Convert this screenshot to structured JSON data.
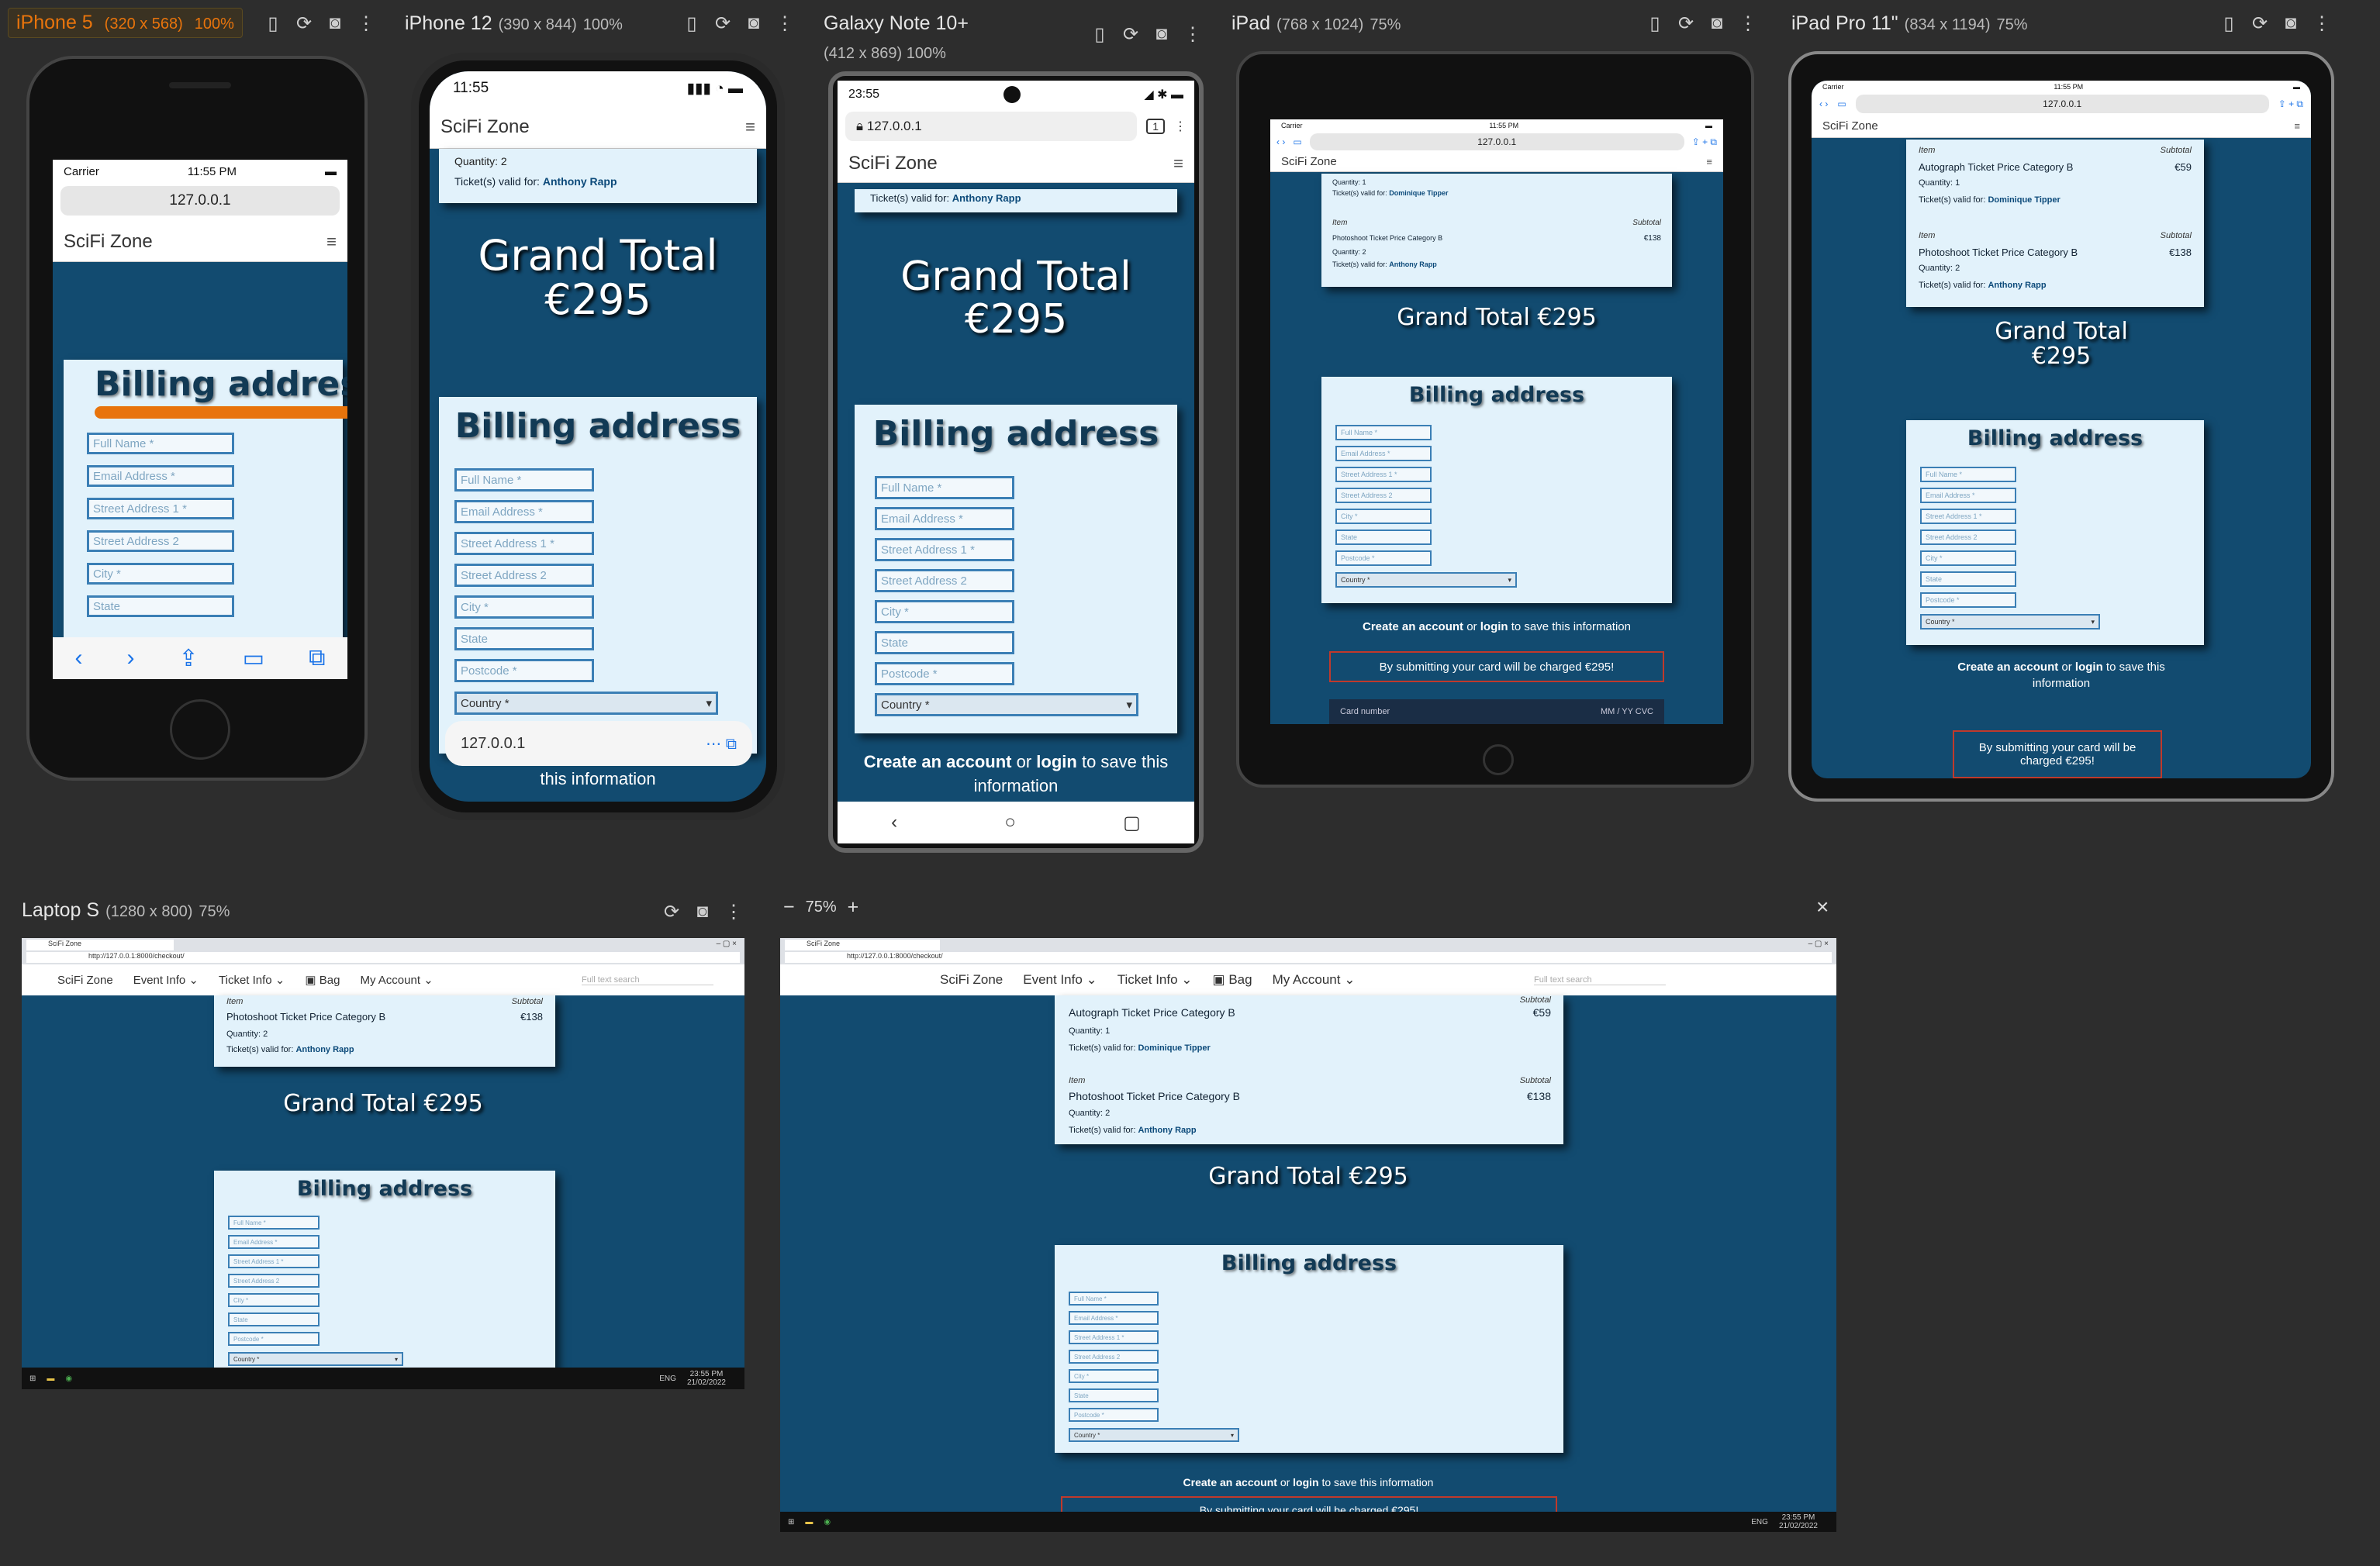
{
  "panels": {
    "iphone5": {
      "name": "iPhone 5",
      "dims": "(320 x 568)",
      "zoom": "100%"
    },
    "iphone12": {
      "name": "iPhone 12",
      "dims": "(390 x 844)",
      "zoom": "100%"
    },
    "galaxy": {
      "name": "Galaxy Note 10+",
      "dims": "(412 x 869)",
      "zoom": "100%"
    },
    "ipad": {
      "name": "iPad",
      "dims": "(768 x 1024)",
      "zoom": "75%"
    },
    "ipadpro": {
      "name": "iPad Pro 11\"",
      "dims": "(834 x 1194)",
      "zoom": "75%"
    },
    "laptop": {
      "name": "Laptop S",
      "dims": "(1280 x 800)",
      "zoom": "75%"
    },
    "custom": {
      "zoom": "75%"
    }
  },
  "status": {
    "carrier": "Carrier",
    "time_ios": "11:55 PM",
    "time_12": "11:55",
    "time_android": "23:55",
    "tabs_count": "1"
  },
  "url": {
    "short": "127.0.0.1",
    "full": "http://127.0.0.1:8000/checkout/"
  },
  "site": {
    "brand": "SciFi Zone",
    "menu": [
      "Event Info",
      "Ticket Info",
      "Bag",
      "My Account"
    ],
    "search_placeholder": "Full text search",
    "tab_title": "SciFi Zone"
  },
  "order": {
    "item_label": "Item",
    "subtotal_label": "Subtotal",
    "items": [
      {
        "name": "Autograph Ticket Price Category B",
        "price": "€59",
        "quantity": "Quantity: 1",
        "valid_label": "Ticket(s) valid for:",
        "holder": "Dominique Tipper"
      },
      {
        "name": "Photoshoot Ticket Price Category B",
        "price": "€138",
        "quantity": "Quantity: 2",
        "valid_label": "Ticket(s) valid for:",
        "holder": "Anthony Rapp"
      }
    ],
    "grand_total_label": "Grand Total",
    "grand_total": "€295",
    "grand_total_full": "Grand Total €295"
  },
  "billing": {
    "title": "Billing address",
    "fields": [
      "Full Name *",
      "Email Address *",
      "Street Address 1 *",
      "Street Address 2",
      "City *",
      "State",
      "Postcode *"
    ],
    "country": "Country *"
  },
  "account_note": {
    "pre": "Create an account",
    "or": "or",
    "login": "login",
    "post": "to save this information",
    "partial": "this information"
  },
  "charge_warning": "By submitting your card will be charged €295!",
  "card": {
    "number": "Card number",
    "expiry": "MM / YY  CVC"
  },
  "taskbar": {
    "lang": "ENG",
    "time": "23:55 PM",
    "date": "21/02/2022"
  },
  "colors": {
    "page_bg": "#124b70",
    "card_bg": "#e2f2fb",
    "warn_border": "#c0392b",
    "label_orange": "#e8740c"
  }
}
